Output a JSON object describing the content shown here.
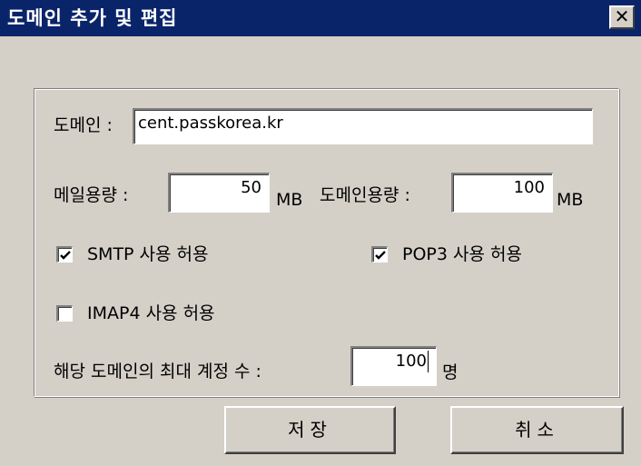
{
  "window": {
    "title": "도메인 추가 및 편집",
    "close_glyph": "✕"
  },
  "form": {
    "domain_label": "도메인 :",
    "domain_value": "cent.passkorea.kr",
    "mail_quota_label": "메일용량 :",
    "mail_quota_value": "50",
    "mail_quota_unit": "MB",
    "domain_quota_label": "도메인용량 :",
    "domain_quota_value": "100",
    "domain_quota_unit": "MB",
    "smtp_label": "SMTP 사용 허용",
    "smtp_checked": true,
    "pop3_label": "POP3 사용 허용",
    "pop3_checked": true,
    "imap4_label": "IMAP4 사용 허용",
    "imap4_checked": false,
    "max_accounts_label": "해당 도메인의 최대 계정 수 :",
    "max_accounts_value": "100",
    "max_accounts_unit": "명"
  },
  "buttons": {
    "save_label": "저장",
    "cancel_label": "취소"
  }
}
